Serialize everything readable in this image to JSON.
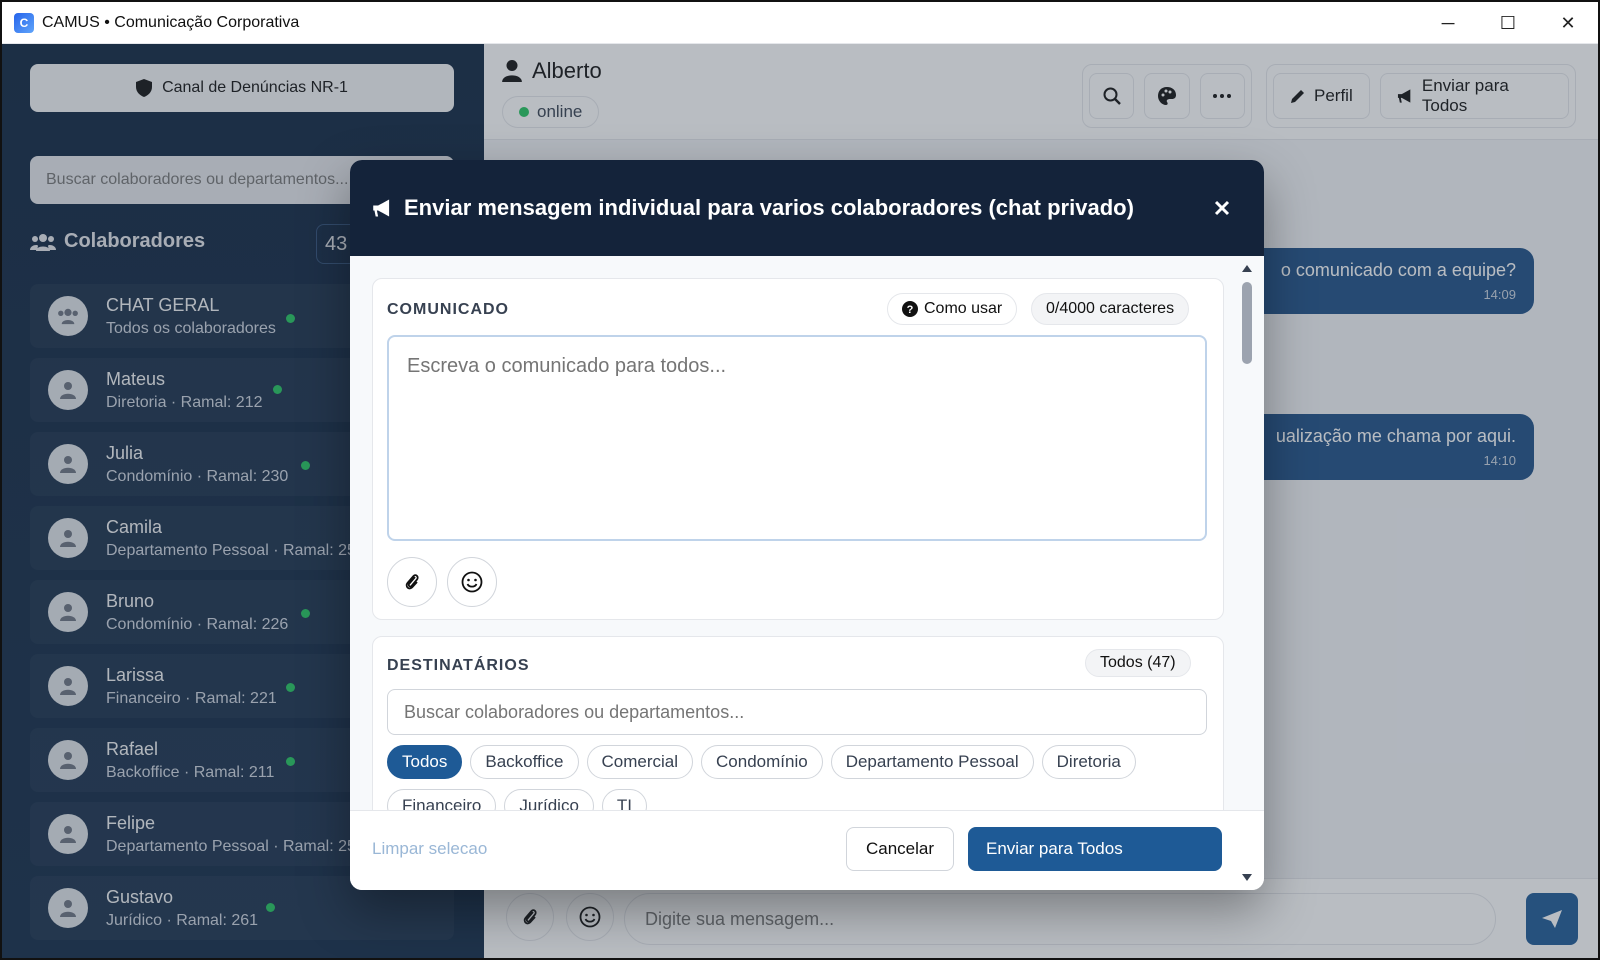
{
  "window": {
    "title": "CAMUS • Comunicação Corporativa",
    "controls": {
      "minimize": "─",
      "maximize": "☐",
      "close": "✕"
    }
  },
  "sidebar": {
    "report_button": "Canal de Denúncias NR-1",
    "search_placeholder": "Buscar colaboradores ou departamentos...",
    "section_title": "Colaboradores",
    "count": "43",
    "contacts": [
      {
        "name": "CHAT GERAL",
        "sub": "Todos os colaboradores"
      },
      {
        "name": "Mateus",
        "sub": "Diretoria · Ramal: 212"
      },
      {
        "name": "Julia",
        "sub": "Condomínio · Ramal: 230"
      },
      {
        "name": "Camila",
        "sub": "Departamento Pessoal · Ramal: 25"
      },
      {
        "name": "Bruno",
        "sub": "Condomínio · Ramal: 226"
      },
      {
        "name": "Larissa",
        "sub": "Financeiro · Ramal: 221"
      },
      {
        "name": "Rafael",
        "sub": "Backoffice · Ramal: 211"
      },
      {
        "name": "Felipe",
        "sub": "Departamento Pessoal · Ramal: 25"
      },
      {
        "name": "Gustavo",
        "sub": "Jurídico · Ramal: 261"
      }
    ]
  },
  "chat": {
    "user_name": "Alberto",
    "status": "online",
    "profile_button": "Perfil",
    "broadcast_button": "Enviar para Todos",
    "messages": [
      {
        "text": "o comunicado com a equipe?",
        "time": "14:09"
      },
      {
        "text": "ualização me chama por aqui.",
        "time": "14:10"
      }
    ],
    "composer_placeholder": "Digite sua mensagem..."
  },
  "modal": {
    "title": "Enviar mensagem individual para varios colaboradores (chat privado)",
    "communique": {
      "title": "COMUNICADO",
      "help": "Como usar",
      "char_count": "0/4000 caracteres",
      "placeholder": "Escreva o comunicado para todos..."
    },
    "recipients": {
      "title": "DESTINATÁRIOS",
      "total": "Todos (47)",
      "search_placeholder": "Buscar colaboradores ou departamentos...",
      "chips": [
        "Todos",
        "Backoffice",
        "Comercial",
        "Condomínio",
        "Departamento Pessoal",
        "Diretoria",
        "Financeiro",
        "Jurídico",
        "TI"
      ]
    },
    "footer": {
      "clear": "Limpar selecao",
      "cancel": "Cancelar",
      "submit": "Enviar para Todos"
    }
  },
  "colors": {
    "sidebar_bg": "#0f2540",
    "modal_header": "#14233a",
    "accent": "#1e5a96",
    "online": "#22c55e"
  }
}
